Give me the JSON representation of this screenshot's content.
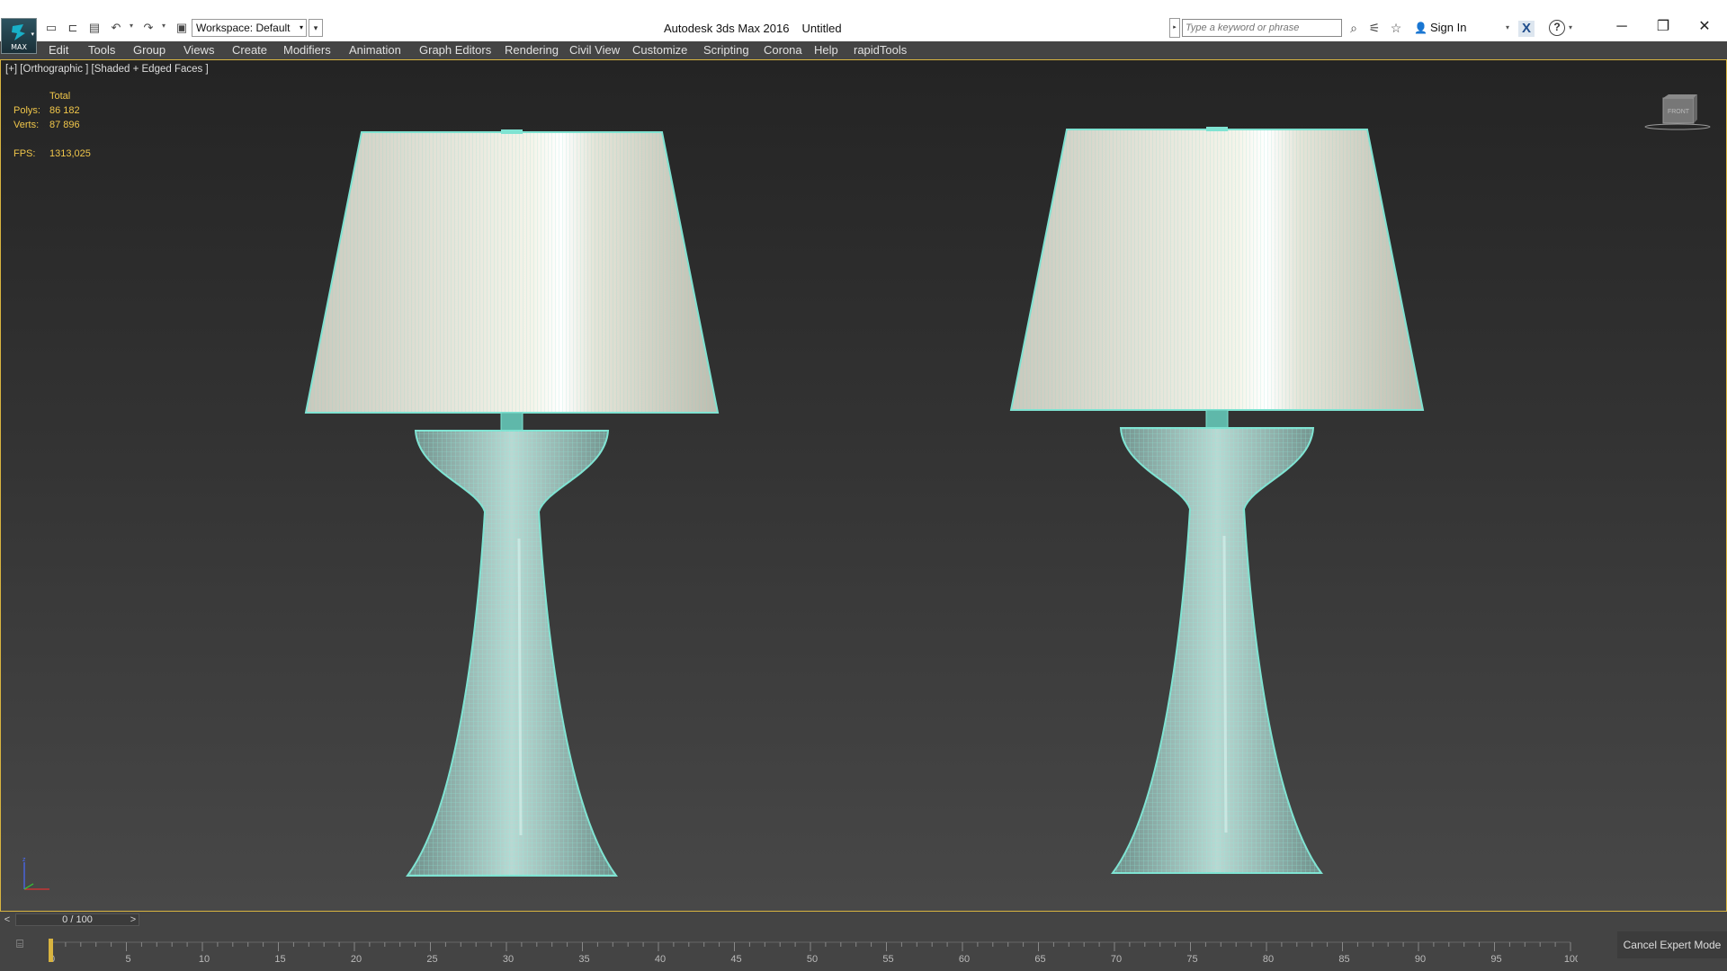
{
  "titlebar": {
    "app_name": "Autodesk 3ds Max 2016",
    "document_name": "Untitled",
    "logo_label": "MAX",
    "workspace_value": "Workspace: Default",
    "search_placeholder": "Type a keyword or phrase",
    "sign_in_label": "Sign In",
    "help_label": "?",
    "exchange_label": "X",
    "minimize": "─",
    "restore": "❐",
    "close": "✕"
  },
  "quick_access": [
    {
      "name": "new-file-icon",
      "glyph": "🗋"
    },
    {
      "name": "open-file-icon",
      "glyph": "🗁"
    },
    {
      "name": "save-file-icon",
      "glyph": "🖫"
    },
    {
      "name": "undo-icon",
      "glyph": "↶"
    },
    {
      "name": "redo-icon",
      "glyph": "↷"
    },
    {
      "name": "project-folder-icon",
      "glyph": "▣"
    }
  ],
  "menu": [
    "Edit",
    "Tools",
    "Group",
    "Views",
    "Create",
    "Modifiers",
    "Animation",
    "Graph Editors",
    "Rendering",
    "Civil View",
    "Customize",
    "Scripting",
    "Corona",
    "Help",
    "rapidTools"
  ],
  "viewport": {
    "label": "[+] [Orthographic ] [Shaded + Edged Faces ]",
    "stats": {
      "header": "Total",
      "polys_label": "Polys:",
      "polys_value": "86 182",
      "verts_label": "Verts:",
      "verts_value": "87 896",
      "fps_label": "FPS:",
      "fps_value": "1313,025"
    },
    "viewcube_label": "FRONT",
    "axis_z": "z",
    "wire_color": "#7fe3d2",
    "shade_color": "#dcdcd0",
    "border_color": "#d8b440"
  },
  "time_slider": {
    "value": "0 / 100",
    "prev": "<",
    "next": ">"
  },
  "track_bar": {
    "labels": [
      "0",
      "5",
      "10",
      "15",
      "20",
      "25",
      "30",
      "35",
      "40",
      "45",
      "50",
      "55",
      "60",
      "65",
      "70",
      "75",
      "80",
      "85",
      "90",
      "95",
      "100"
    ],
    "current_frame": 0
  },
  "status": {
    "cancel_expert_mode": "Cancel Expert Mode"
  }
}
